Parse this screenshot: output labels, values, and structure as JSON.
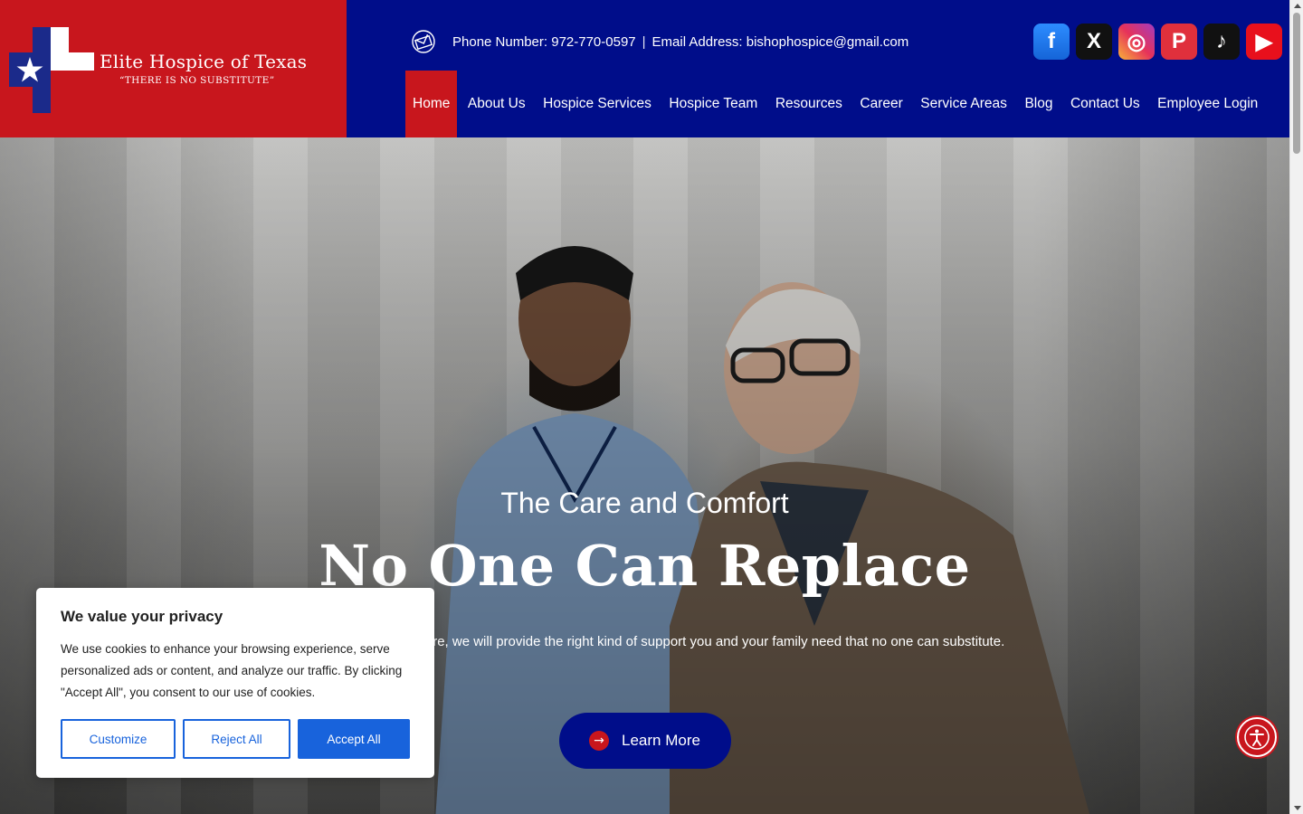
{
  "logo": {
    "title": "Elite Hospice of Texas",
    "tagline": "“THERE IS NO SUBSTITUTE”",
    "icon": "texas-flag-cross-icon"
  },
  "contact": {
    "icon": "envelope-icon",
    "phone": "Phone Number: 972-770-0597",
    "separator": "|",
    "email": "Email Address: bishophospice@gmail.com"
  },
  "socials": [
    {
      "name": "facebook",
      "glyph": "f"
    },
    {
      "name": "x",
      "glyph": "X"
    },
    {
      "name": "instagram",
      "glyph": "◎"
    },
    {
      "name": "pinterest",
      "glyph": "P"
    },
    {
      "name": "tiktok",
      "glyph": "♪"
    },
    {
      "name": "youtube",
      "glyph": "▶"
    }
  ],
  "nav": {
    "items": [
      "Home",
      "About Us",
      "Hospice Services",
      "Hospice Team",
      "Resources",
      "Career",
      "Service Areas",
      "Blog",
      "Contact Us",
      "Employee Login"
    ],
    "active": "Home"
  },
  "hero": {
    "kicker": "The Care and Comfort",
    "title": "No One Can Replace",
    "subtitle": "hospice and palliative care, we will provide the right kind of support you and your family need that no one can substitute.",
    "button": "Learn More",
    "button_icon": "arrow-right-icon"
  },
  "accessibility": {
    "icon": "accessibility-icon"
  },
  "cookie": {
    "title": "We value your privacy",
    "text": "We use cookies to enhance your browsing experience, serve personalized ads or content, and analyze our traffic. By clicking \"Accept All\", you consent to our use of cookies.",
    "customize": "Customize",
    "reject": "Reject All",
    "accept": "Accept All"
  },
  "colors": {
    "brand_blue": "#000d8a",
    "brand_red": "#c8161d",
    "cookie_blue": "#1863dc"
  }
}
